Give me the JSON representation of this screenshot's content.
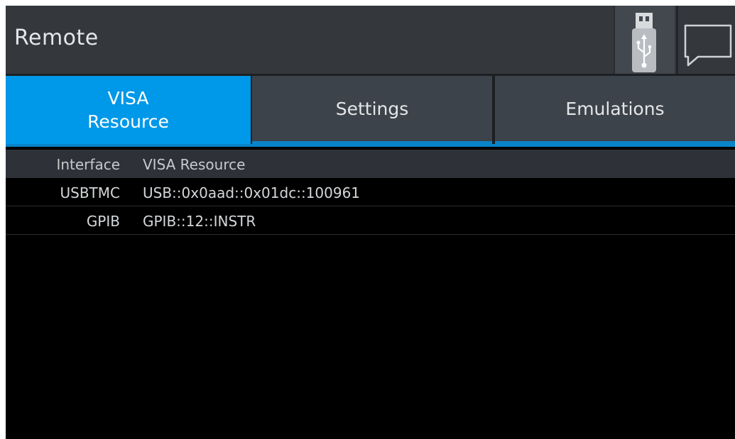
{
  "window": {
    "title": "Remote"
  },
  "header_icons": [
    "usb-icon",
    "message-icon"
  ],
  "tabs": [
    {
      "label_line1": "VISA",
      "label_line2": "Resource",
      "active": true
    },
    {
      "label": "Settings",
      "active": false
    },
    {
      "label": "Emulations",
      "active": false
    }
  ],
  "table": {
    "headers": {
      "interface": "Interface",
      "resource": "VISA Resource"
    },
    "rows": [
      {
        "interface": "USBTMC",
        "resource": "USB::0x0aad::0x01dc::100961"
      },
      {
        "interface": "GPIB",
        "resource": "GPIB::12::INSTR"
      }
    ]
  },
  "colors": {
    "active_tab": "#0098e8",
    "tab_underline": "#0a84c8",
    "titlebar": "#34383d",
    "background": "#000000"
  }
}
